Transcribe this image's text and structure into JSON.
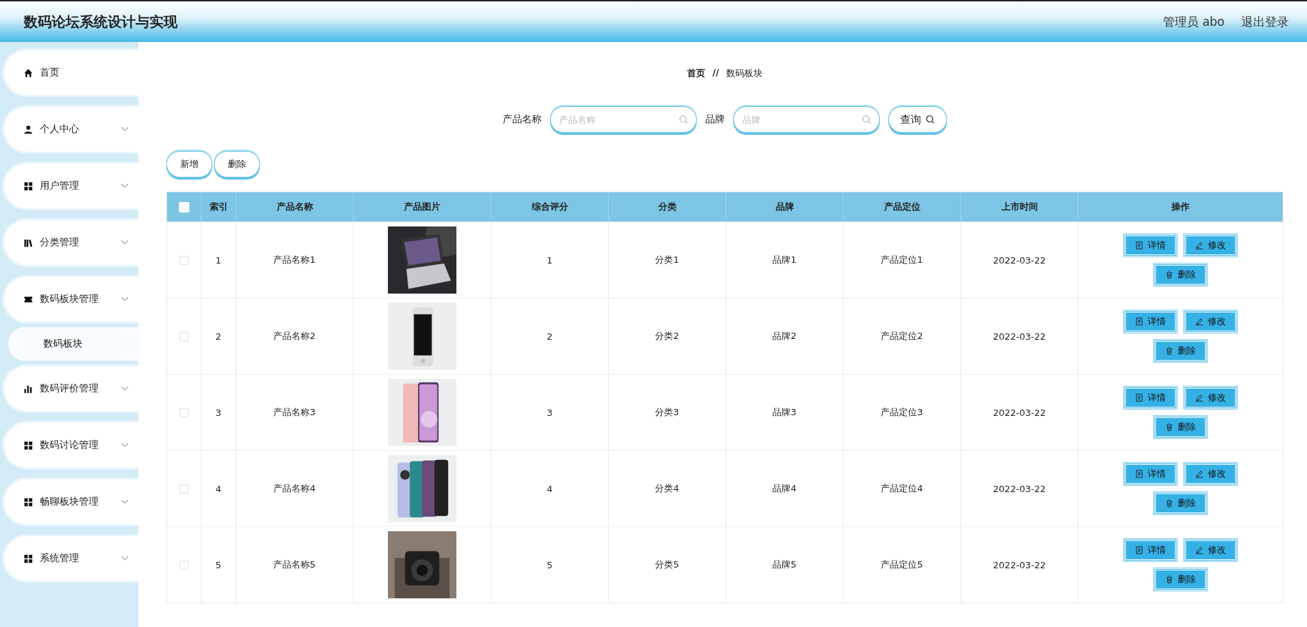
{
  "header": {
    "title": "数码论坛系统设计与实现",
    "user": "管理员 abo",
    "logout": "退出登录"
  },
  "sidebar": {
    "items": [
      {
        "label": "首页",
        "has_arrow": false
      },
      {
        "label": "个人中心",
        "has_arrow": true
      },
      {
        "label": "用户管理",
        "has_arrow": true
      },
      {
        "label": "分类管理",
        "has_arrow": true
      },
      {
        "label": "数码板块管理",
        "has_arrow": true,
        "children": [
          {
            "label": "数码板块",
            "selected": true
          }
        ]
      },
      {
        "label": "数码评价管理",
        "has_arrow": true
      },
      {
        "label": "数码讨论管理",
        "has_arrow": true
      },
      {
        "label": "畅聊板块管理",
        "has_arrow": true
      },
      {
        "label": "系统管理",
        "has_arrow": true
      }
    ]
  },
  "breadcrumb": {
    "home": "首页",
    "separator": "//",
    "current": "数码板块"
  },
  "search": {
    "fields": [
      {
        "label": "产品名称",
        "placeholder": "产品名称"
      },
      {
        "label": "品牌",
        "placeholder": "品牌"
      }
    ],
    "button": "查询"
  },
  "actions": [
    "新增",
    "删除"
  ],
  "table": {
    "select_all_checked": false,
    "columns": [
      "索引",
      "产品名称",
      "产品图片",
      "综合评分",
      "分类",
      "品牌",
      "产品定位",
      "上市时间",
      "操作"
    ],
    "rows": [
      {
        "checked": false,
        "cells": [
          "1",
          "产品名称1",
          "",
          "1",
          "分类1",
          "品牌1",
          "产品定位1",
          "2022-03-22"
        ],
        "buttons": [
          "详情",
          "修改",
          "删除"
        ]
      },
      {
        "checked": false,
        "cells": [
          "2",
          "产品名称2",
          "",
          "2",
          "分类2",
          "品牌2",
          "产品定位2",
          "2022-03-22"
        ],
        "buttons": [
          "详情",
          "修改",
          "删除"
        ]
      },
      {
        "checked": false,
        "cells": [
          "3",
          "产品名称3",
          "",
          "3",
          "分类3",
          "品牌3",
          "产品定位3",
          "2022-03-22"
        ],
        "buttons": [
          "详情",
          "修改",
          "删除"
        ]
      },
      {
        "checked": false,
        "cells": [
          "4",
          "产品名称4",
          "",
          "4",
          "分类4",
          "品牌4",
          "产品定位4",
          "2022-03-22"
        ],
        "buttons": [
          "详情",
          "修改",
          "删除"
        ]
      },
      {
        "checked": false,
        "cells": [
          "5",
          "产品名称5",
          "",
          "5",
          "分类5",
          "品牌5",
          "产品定位5",
          "2022-03-22"
        ],
        "buttons": [
          "详情",
          "修改",
          "删除"
        ]
      }
    ]
  }
}
